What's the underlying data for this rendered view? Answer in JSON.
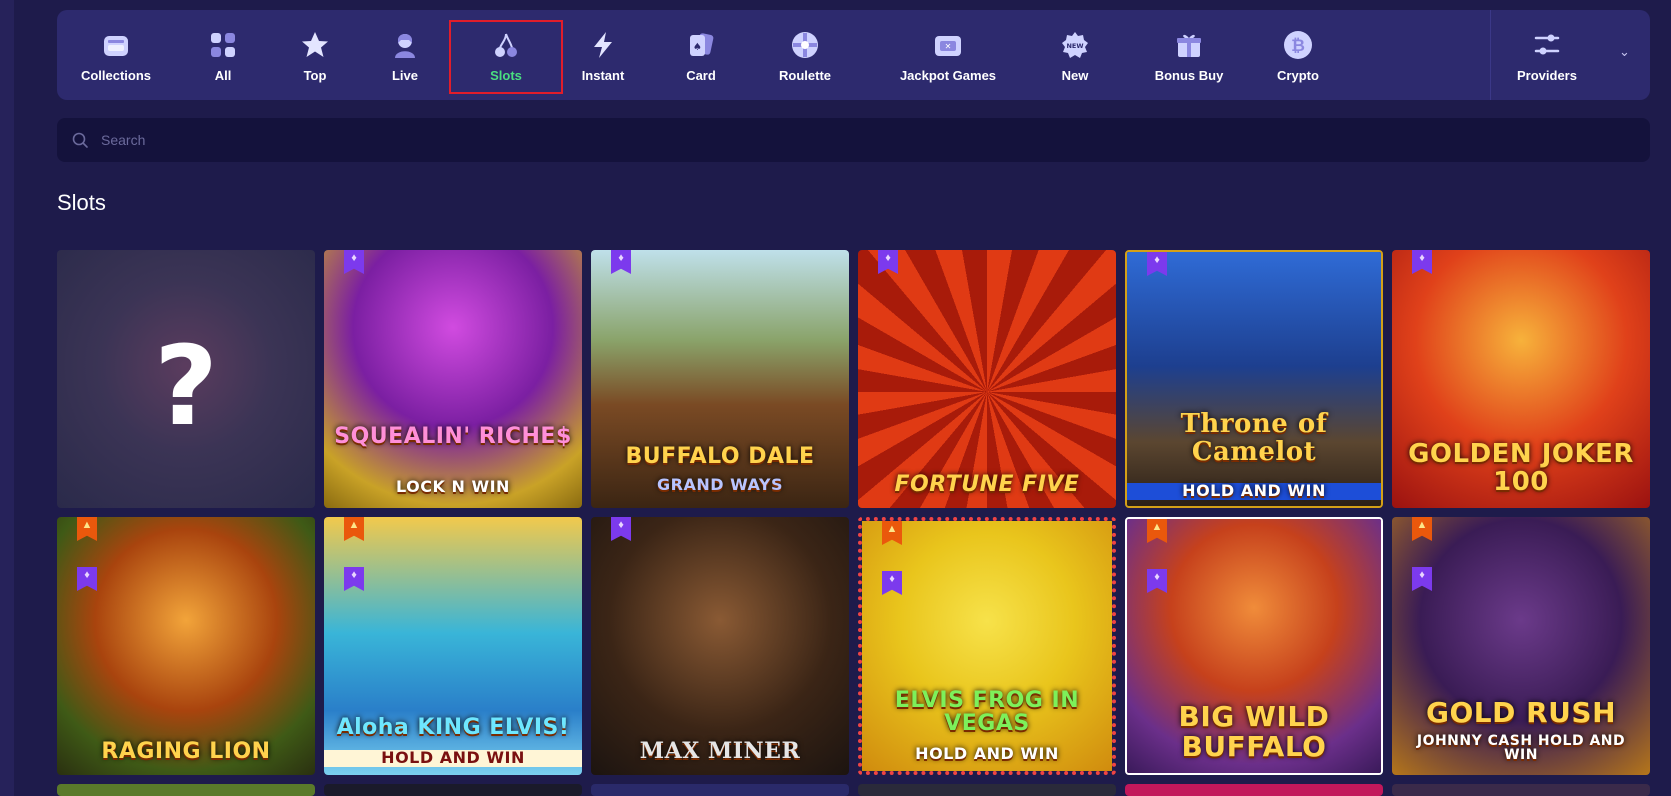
{
  "nav": {
    "items": [
      {
        "label": "Collections",
        "icon": "collections-icon"
      },
      {
        "label": "All",
        "icon": "grid-icon"
      },
      {
        "label": "Top",
        "icon": "star-icon"
      },
      {
        "label": "Live",
        "icon": "dealer-icon"
      },
      {
        "label": "Slots",
        "icon": "cherry-icon",
        "active": true
      },
      {
        "label": "Instant",
        "icon": "lightning-icon"
      },
      {
        "label": "Card",
        "icon": "cards-icon"
      },
      {
        "label": "Roulette",
        "icon": "roulette-icon"
      },
      {
        "label": "Jackpot Games",
        "icon": "jackpot-icon"
      },
      {
        "label": "New",
        "icon": "new-badge-icon"
      },
      {
        "label": "Bonus Buy",
        "icon": "gift-icon"
      },
      {
        "label": "Crypto",
        "icon": "bitcoin-icon"
      }
    ],
    "providers_label": "Providers",
    "active_color": "#4ade80"
  },
  "search": {
    "placeholder": "Search"
  },
  "section_title": "Slots",
  "games": [
    {
      "title": "?",
      "badge": "",
      "mystery": true
    },
    {
      "title": "SQUEALIN' RICHE$",
      "subtitle": "LOCK N WIN",
      "badge": "diamond"
    },
    {
      "title": "BUFFALO DALE",
      "subtitle": "GRAND WAYS",
      "badge": "diamond"
    },
    {
      "title": "FORTUNE FIVE",
      "subtitle": "",
      "badge": "diamond"
    },
    {
      "title": "Throne of Camelot",
      "subtitle": "HOLD AND WIN",
      "badge": "diamond"
    },
    {
      "title": "GOLDEN JOKER 100",
      "subtitle": "",
      "badge": "diamond"
    },
    {
      "title": "RAGING LION",
      "subtitle": "",
      "badge": "fire+diamond"
    },
    {
      "title": "Aloha KING ELVIS!",
      "subtitle": "HOLD AND WIN",
      "badge": "fire+diamond"
    },
    {
      "title": "MAX MINER",
      "subtitle": "",
      "badge": "diamond"
    },
    {
      "title": "ELVIS FROG IN VEGAS",
      "subtitle": "HOLD AND WIN",
      "badge": "fire+diamond"
    },
    {
      "title": "BIG WILD BUFFALO",
      "subtitle": "",
      "badge": "fire+diamond"
    },
    {
      "title": "GOLD RUSH",
      "subtitle": "JOHNNY CASH HOLD AND WIN",
      "badge": "fire+diamond"
    }
  ]
}
